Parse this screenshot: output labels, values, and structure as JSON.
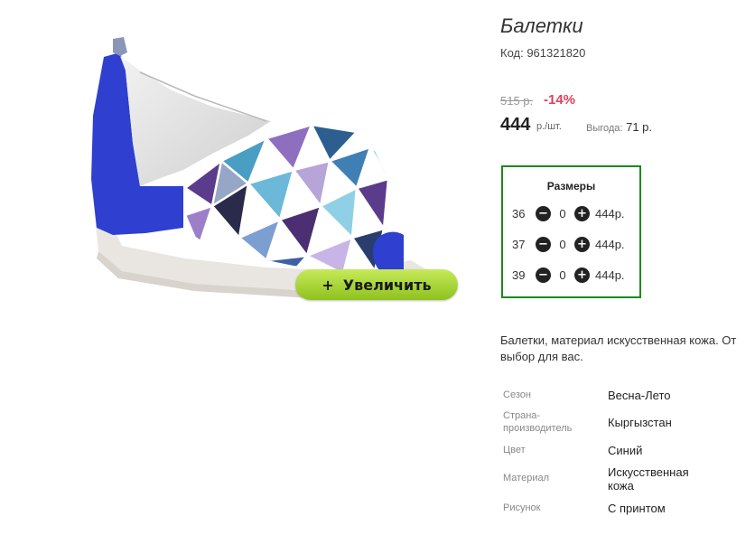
{
  "product": {
    "title": "Балетки",
    "code": "Код: 961321820",
    "old_price": "515 р.",
    "discount": "-14%",
    "price": "444",
    "price_unit": "р./шт.",
    "saving_label": "Выгода:",
    "saving_value": "71 р.",
    "zoom_label": "Увеличить",
    "zoom_plus": "+"
  },
  "sizes": {
    "title": "Размеры",
    "minus_icon": "−",
    "plus_icon": "+",
    "rows": [
      {
        "size": "36",
        "qty": "0",
        "price": "444р."
      },
      {
        "size": "37",
        "qty": "0",
        "price": "444р."
      },
      {
        "size": "39",
        "qty": "0",
        "price": "444р."
      }
    ]
  },
  "description": {
    "line1": "Балетки, материал искусственная кожа. От",
    "line2": "выбор для вас."
  },
  "specs": [
    {
      "label": "Сезон",
      "value": "Весна-Лето"
    },
    {
      "label_line1": "Страна-",
      "label_line2": "производитель",
      "value": "Кыргызстан"
    },
    {
      "label": "Цвет",
      "value": "Синий"
    },
    {
      "label": "Материал",
      "value_line1": "Искусственная",
      "value_line2": "кожа"
    },
    {
      "label": "Рисунок",
      "value": "С принтом"
    }
  ],
  "colors": {
    "accent_green": "#1a8a1a",
    "discount_red": "#e0405a",
    "zoom_button": "#9dcc2c",
    "shoe_blue": "#2f3fd0"
  }
}
